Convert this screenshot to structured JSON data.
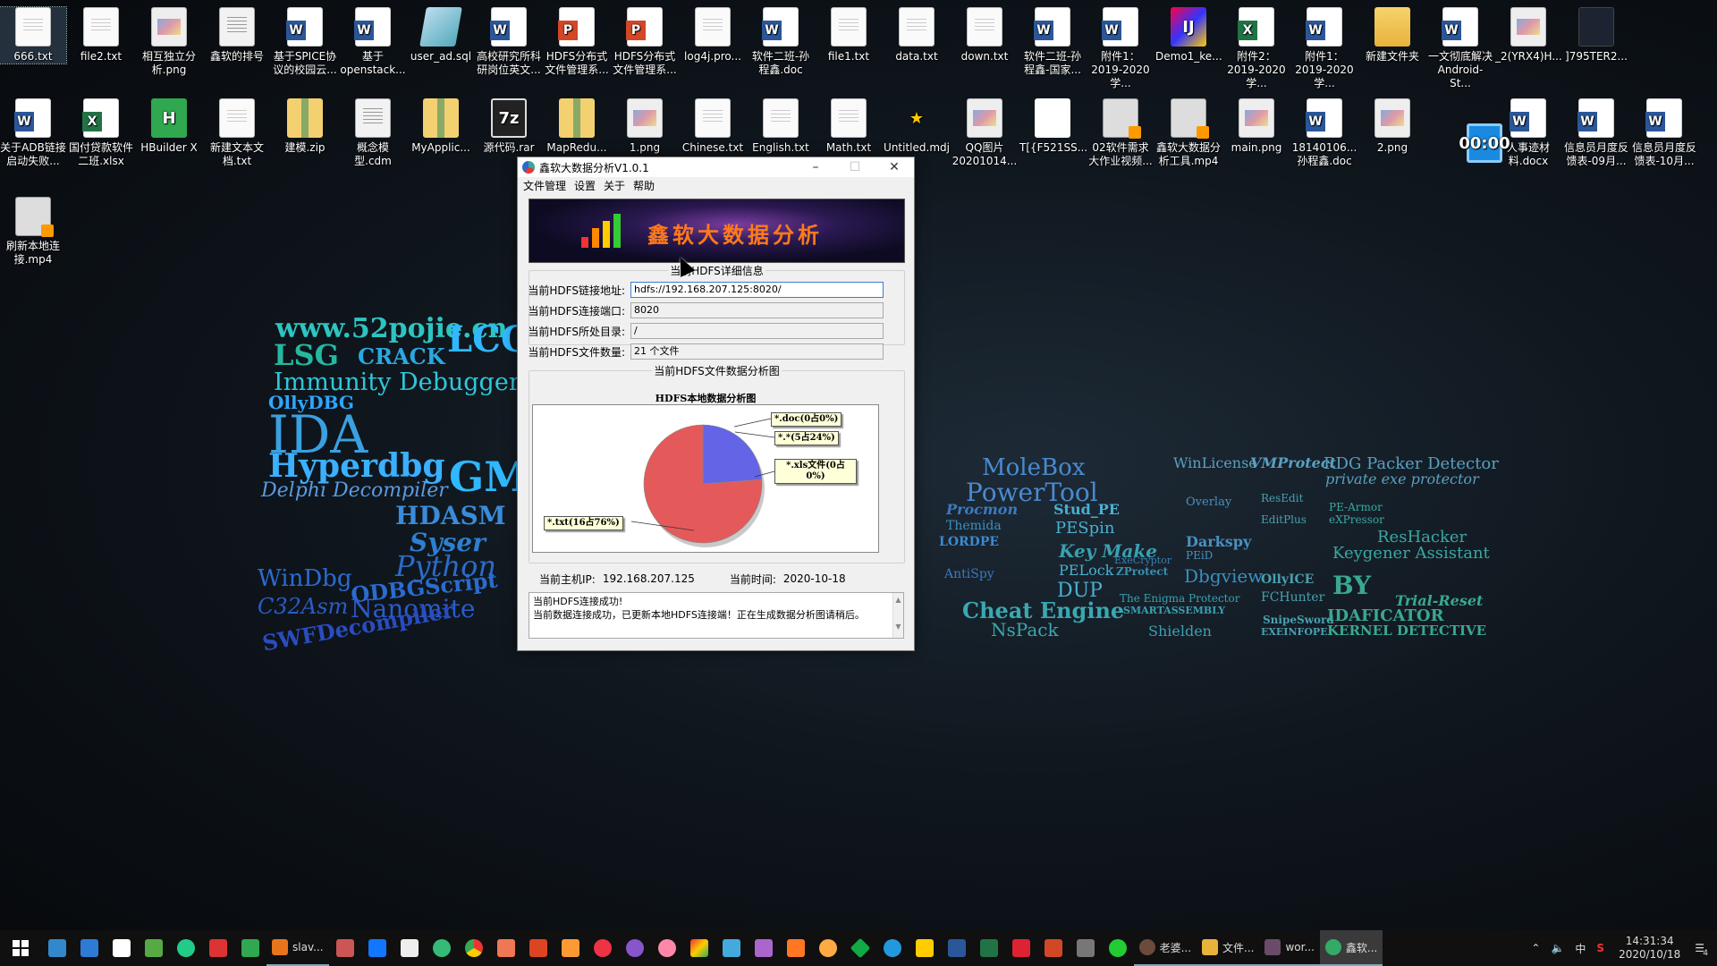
{
  "desktop": {
    "row1": [
      {
        "label": "666.txt",
        "icon": "text-file-icon",
        "selected": true
      },
      {
        "label": "file2.txt",
        "icon": "text-file-icon"
      },
      {
        "label": "相互独立分析.png",
        "icon": "image-file-icon"
      },
      {
        "label": "鑫软的排号",
        "icon": "document-icon"
      },
      {
        "label": "基于SPICE协议的校园云...",
        "icon": "word-doc-icon"
      },
      {
        "label": "基于openstack...",
        "icon": "word-doc-icon"
      },
      {
        "label": "user_ad.sql",
        "icon": "sql-file-icon"
      },
      {
        "label": "高校研究所科研岗位英文...",
        "icon": "word-doc-icon"
      },
      {
        "label": "HDFS分布式文件管理系...",
        "icon": "ppt-file-icon"
      },
      {
        "label": "HDFS分布式文件管理系...",
        "icon": "ppt-file-icon"
      },
      {
        "label": "log4j.pro...",
        "icon": "text-file-icon"
      },
      {
        "label": "软件二班-孙程鑫.doc",
        "icon": "word-doc-icon"
      },
      {
        "label": "file1.txt",
        "icon": "text-file-icon"
      },
      {
        "label": "data.txt",
        "icon": "text-file-icon"
      },
      {
        "label": "down.txt",
        "icon": "text-file-icon"
      },
      {
        "label": "软件二班-孙程鑫-国家...",
        "icon": "word-doc-icon"
      },
      {
        "label": "附件1：2019-2020学...",
        "icon": "word-doc-icon"
      },
      {
        "label": "Demo1_ke...",
        "icon": "intellij-icon"
      },
      {
        "label": "附件2：2019-2020学...",
        "icon": "excel-file-icon"
      },
      {
        "label": "附件1：2019-2020学...",
        "icon": "word-doc-icon"
      },
      {
        "label": "新建文件夹",
        "icon": "folder-icon"
      },
      {
        "label": "一文彻底解决Android-St...",
        "icon": "word-doc-icon"
      },
      {
        "label": "_2(YRX4)H...",
        "icon": "image-file-icon"
      },
      {
        "label": "]795TER2...",
        "icon": "dark-image-icon"
      }
    ],
    "row2": [
      {
        "label": "关于ADB链接启动失败...",
        "icon": "word-doc-icon"
      },
      {
        "label": "国付贷款软件二班.xlsx",
        "icon": "excel-file-icon"
      },
      {
        "label": "HBuilder X",
        "icon": "hbuilder-icon"
      },
      {
        "label": "新建文本文档.txt",
        "icon": "text-file-icon"
      },
      {
        "label": "建模.zip",
        "icon": "zip-file-icon"
      },
      {
        "label": "概念模型.cdm",
        "icon": "cdm-file-icon"
      },
      {
        "label": "MyApplic...",
        "icon": "zip-file-icon"
      },
      {
        "label": "源代码.rar",
        "icon": "7zip-icon"
      },
      {
        "label": "MapRedu...",
        "icon": "zip-file-icon"
      },
      {
        "label": "1.png",
        "icon": "image-file-icon"
      },
      {
        "label": "Chinese.txt",
        "icon": "text-file-icon"
      },
      {
        "label": "English.txt",
        "icon": "text-file-icon"
      },
      {
        "label": "Math.txt",
        "icon": "text-file-icon"
      },
      {
        "label": "Untitled.mdj",
        "icon": "star-file-icon"
      },
      {
        "label": "QQ图片20201014...",
        "icon": "image-file-icon"
      },
      {
        "label": "T[{F521SS...",
        "icon": "slim-image-icon"
      },
      {
        "label": "02软件需求大作业视频...",
        "icon": "video-file-icon"
      },
      {
        "label": "鑫软大数据分析工具.mp4",
        "icon": "video-file-icon"
      },
      {
        "label": "main.png",
        "icon": "image-file-icon"
      },
      {
        "label": "18140106...孙程鑫.doc",
        "icon": "word-doc-icon"
      },
      {
        "label": "2.png",
        "icon": "image-file-icon"
      }
    ],
    "row2_right": [
      {
        "label": "人事迹材料.docx",
        "icon": "word-doc-icon"
      },
      {
        "label": "信息员月度反馈表-09月...",
        "icon": "word-doc-icon"
      },
      {
        "label": "信息员月度反馈表-10月...",
        "icon": "word-doc-icon"
      }
    ],
    "row3": [
      {
        "label": "刷新本地连接.mp4",
        "icon": "video-file-icon"
      }
    ],
    "recorder_timer": "00:00"
  },
  "wallpaper": {
    "left": [
      "www.52pojie.cn",
      "LCG",
      "LSG",
      "CRACK",
      "Immunity Debugger",
      "OllyDBG",
      "IDA",
      "Hyperdbg",
      "GMER",
      "Delphi Decompiler",
      "HDASM",
      "Syser",
      "Python",
      "WinDbg",
      "ODBGScript",
      "C32Asm",
      "Nanomite",
      "SWFDecompiler"
    ],
    "mid": [
      "MoleBox",
      "PowerTool",
      "Procmon",
      "Themida",
      "LORDPE",
      "AntiSpy",
      "Cheat Engine",
      "NsPack",
      "Stud_PE",
      "PESpin",
      "Key Make",
      "PELock",
      "DUP"
    ],
    "right": [
      "WinLicense",
      "VMProtect",
      "RDG Packer Detector",
      "private exe protector",
      "Overlay",
      "ResEdit",
      "Darkspy",
      "PEiD",
      "EditPlus",
      "ExeCryptor",
      "ZProtect",
      "The Enigma Protector",
      "SMARTASSEMBLY",
      "Shielden",
      "Dbgview",
      "OllyICE",
      "FCHunter",
      "SnipeSword",
      "EXEINFOPE",
      "ResHacker",
      "Keygener Assistant",
      "BY",
      "Trial-Reset",
      "IDAFICATOR",
      "KERNEL DETECTIVE",
      "PE-Armor",
      "eXPressor"
    ]
  },
  "window": {
    "title": "鑫软大数据分析V1.0.1",
    "menu": [
      "文件管理",
      "设置",
      "关于",
      "帮助"
    ],
    "banner_title": "鑫软大数据分析",
    "details_group_title": "当前HDFS详细信息",
    "fields": [
      {
        "label": "当前HDFS链接地址:",
        "value": "hdfs://192.168.207.125:8020/"
      },
      {
        "label": "当前HDFS连接端口:",
        "value": "8020"
      },
      {
        "label": "当前HDFS所处目录:",
        "value": "/"
      },
      {
        "label": "当前HDFS文件数量:",
        "value": "21 个文件"
      }
    ],
    "chart_group_title": "当前HDFS文件数据分析图",
    "host_ip_label": "当前主机IP:",
    "host_ip": "192.168.207.125",
    "time_label": "当前时间:",
    "time_value": "2020-10-18",
    "log": [
      "当前HDFS连接成功!",
      "当前数据连接成功，已更新本地HDFS连接端！正在生成数据分析图请稍后。"
    ]
  },
  "chart_data": {
    "type": "pie",
    "title": "HDFS本地数据分析图",
    "slices": [
      {
        "name": "*.doc",
        "label": "*.doc(0占0%)",
        "count": 0,
        "percent": 0,
        "color": "#e04848"
      },
      {
        "name": "*.*",
        "label": "*.*(5占24%)",
        "count": 5,
        "percent": 24,
        "color": "#6464e6"
      },
      {
        "name": "*.xls文件",
        "label": "*.xls文件(0占0%)",
        "count": 0,
        "percent": 0,
        "color": "#33aa33"
      },
      {
        "name": "*.txt",
        "label": "*.txt(16占76%)",
        "count": 16,
        "percent": 76,
        "color": "#e45a5a"
      }
    ]
  },
  "taskbar": {
    "apps": [
      {
        "label": "slav...",
        "color": "#e8741b"
      },
      {
        "label": "老婆...",
        "color": "#6b4b3a"
      },
      {
        "label": "文件...",
        "color": "#e8b23b"
      },
      {
        "label": "wor...",
        "color": "#6b4b6a"
      },
      {
        "label": "鑫软...",
        "color": "#33aa66",
        "active": true
      }
    ],
    "ime": "中",
    "time": "14:31:34",
    "date": "2020/10/18",
    "notifications": "4"
  }
}
